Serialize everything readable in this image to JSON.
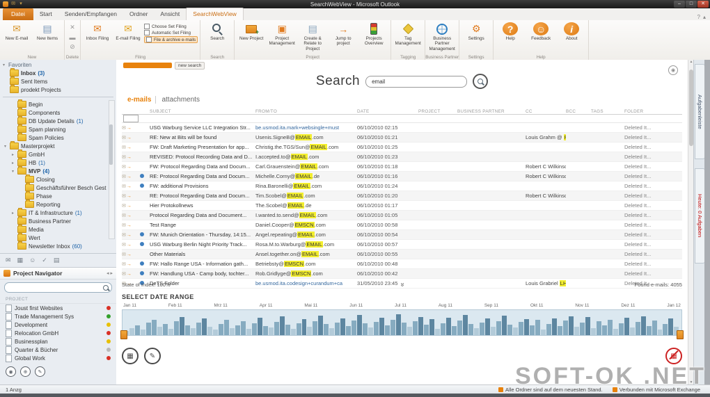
{
  "window": {
    "title": "SearchWebView - Microsoft Outlook"
  },
  "ribbon": {
    "tabs": [
      {
        "label": "Datei",
        "file": true
      },
      {
        "label": "Start"
      },
      {
        "label": "Senden/Empfangen"
      },
      {
        "label": "Ordner"
      },
      {
        "label": "Ansicht"
      },
      {
        "label": "SearchWebView",
        "active": true
      }
    ],
    "groups": [
      {
        "label": "New",
        "buttons": [
          {
            "label": "New E-mail",
            "icon": "new-email"
          },
          {
            "label": "New Items",
            "icon": "new-items"
          }
        ]
      },
      {
        "label": "Delete",
        "icons": [
          "ignore",
          "sweep",
          "junk"
        ]
      },
      {
        "label": "Filing",
        "buttons": [
          {
            "label": "Inbox Filing",
            "icon": "inbox-filing"
          },
          {
            "label": "E-mail Filing",
            "icon": "email-filing"
          }
        ],
        "checks": [
          "Choose Set Filing",
          "Automatic Set Filing",
          "File & archive e-mails"
        ]
      },
      {
        "label": "Search",
        "buttons": [
          {
            "label": "Search",
            "icon": "search"
          }
        ]
      },
      {
        "label": "Project",
        "buttons": [
          {
            "label": "New Project",
            "icon": "new-project"
          },
          {
            "label": "Project Management",
            "icon": "project-management"
          },
          {
            "label": "Create & Relate to Project",
            "icon": "create-relate"
          },
          {
            "label": "Jump to project",
            "icon": "jump-project"
          },
          {
            "label": "Projects Overview",
            "icon": "projects-overview"
          }
        ]
      },
      {
        "label": "Tagging",
        "buttons": [
          {
            "label": "Tag Management",
            "icon": "tag-management"
          }
        ]
      },
      {
        "label": "Business Partner",
        "buttons": [
          {
            "label": "Business Partner Management",
            "icon": "business-partner"
          }
        ]
      },
      {
        "label": "Settings",
        "buttons": [
          {
            "label": "Settings",
            "icon": "settings"
          }
        ]
      },
      {
        "label": "Help",
        "buttons": [
          {
            "label": "Help",
            "icon": "help"
          },
          {
            "label": "Feedback",
            "icon": "feedback"
          },
          {
            "label": "About",
            "icon": "about"
          }
        ]
      }
    ]
  },
  "nav": {
    "favorites_header": "Favoriten",
    "favorites": [
      {
        "label": "Inbox",
        "count": "3",
        "bold": true
      },
      {
        "label": "Sent Items"
      },
      {
        "label": "prodekt Projects"
      }
    ],
    "tree": [
      {
        "label": "Begin",
        "level": 1
      },
      {
        "label": "Components",
        "level": 1
      },
      {
        "label": "DB Update Details",
        "count": "1",
        "level": 1
      },
      {
        "label": "Spam planning",
        "level": 1
      },
      {
        "label": "Spam Policies",
        "level": 1
      },
      {
        "label": "Masterprojekt",
        "level": 0,
        "arrow": "▾"
      },
      {
        "label": "GmbH",
        "level": 1,
        "arrow": "▸"
      },
      {
        "label": "HB",
        "count": "1",
        "level": 1,
        "arrow": "▸"
      },
      {
        "label": "MVP",
        "count": "4",
        "level": 1,
        "arrow": "▾",
        "bold": true
      },
      {
        "label": "Closing",
        "level": 2
      },
      {
        "label": "Geschäftsführer Besch Gest",
        "level": 2
      },
      {
        "label": "Phase",
        "level": 2
      },
      {
        "label": "Reporting",
        "level": 2
      },
      {
        "label": "IT & Infrastructure",
        "count": "1",
        "level": 1,
        "arrow": "▸"
      },
      {
        "label": "Business Partner",
        "level": 1
      },
      {
        "label": "Media",
        "level": 1
      },
      {
        "label": "Wert",
        "level": 1
      },
      {
        "label": "Newsletter Inbox",
        "count": "60",
        "level": 1
      }
    ],
    "modules": [
      "mail",
      "calendar",
      "contacts",
      "tasks",
      "notes"
    ],
    "project_navigator": {
      "title": "Project Navigator",
      "header": "PROJECT",
      "search_value": "",
      "items": [
        {
          "label": "Joust first Websites",
          "status": "#d93025"
        },
        {
          "label": "Trade Management Sys",
          "status": "#34a02c"
        },
        {
          "label": "Development",
          "status": "#e8c000"
        },
        {
          "label": "Relocation GmbH",
          "status": "#d93025"
        },
        {
          "label": "Businessplan",
          "status": "#e8c000"
        },
        {
          "label": "Quarter & Bücher",
          "status": "#b9b9b9"
        },
        {
          "label": "Global Work",
          "status": "#d93025"
        }
      ]
    }
  },
  "search": {
    "title": "Search",
    "value": "email",
    "new_search_label": "new search",
    "tabs": [
      {
        "label": "e-mails",
        "active": true
      },
      {
        "label": "attachments",
        "active": false
      }
    ]
  },
  "table": {
    "columns": [
      "",
      "",
      "SUBJECT",
      "FROM/TO",
      "DATE",
      "PROJECT",
      "BUSINESS PARTNER",
      "CC",
      "BCC",
      "TAGS",
      "FOLDER"
    ],
    "rows": [
      {
        "attach": false,
        "link": true,
        "subject": "USG Warburg Service LLC Integration Str...",
        "from_pre": "be.usmod.ita.mark+websingle+must",
        "from_hl": "",
        "from_post": "",
        "date": "06/10/2010 02:15",
        "project": "",
        "partner": "",
        "cc_pre": "",
        "cc_hl": "",
        "cc_post": "",
        "bcc": "",
        "tags": "",
        "folder": "Deleted It..."
      },
      {
        "attach": false,
        "link": false,
        "subject": "RE: New at Bits will be found",
        "from_pre": "Usenis.SigneB@",
        "from_hl": "EMAIL",
        "from_post": ".com",
        "date": "06/10/2010 01:21",
        "project": "",
        "partner": "",
        "cc_pre": "Louis Grahm @ ",
        "cc_hl": "PM",
        "cc_post": "",
        "bcc": "",
        "tags": "",
        "folder": "Deleted It..."
      },
      {
        "attach": false,
        "link": false,
        "subject": "FW: Draft Marketing Presentation for app...",
        "from_pre": "Christig.the.TGS/Sun@",
        "from_hl": "EMAIL",
        "from_post": ".com",
        "date": "06/10/2010 01:25",
        "project": "",
        "partner": "",
        "cc_pre": "",
        "cc_hl": "",
        "cc_post": "",
        "bcc": "",
        "tags": "",
        "folder": "Deleted It..."
      },
      {
        "attach": false,
        "link": false,
        "subject": "REVISED: Protocol Recording Data and D...",
        "from_pre": "I.accepted.to@",
        "from_hl": "EMAIL",
        "from_post": ".com",
        "date": "06/10/2010 01:23",
        "project": "",
        "partner": "",
        "cc_pre": "",
        "cc_hl": "",
        "cc_post": "",
        "bcc": "",
        "tags": "",
        "folder": "Deleted It..."
      },
      {
        "attach": false,
        "link": false,
        "subject": "FW: Protocol Regarding Data and Docum...",
        "from_pre": "Carl.Grauenstein@",
        "from_hl": "EMAIL",
        "from_post": ".com",
        "date": "06/10/2010 01:18",
        "project": "",
        "partner": "",
        "cc_pre": "Robert C Wilkinson",
        "cc_hl": "",
        "cc_post": "",
        "bcc": "",
        "tags": "",
        "folder": "Deleted It..."
      },
      {
        "attach": true,
        "link": false,
        "subject": "RE: Protocol Regarding Data and Docum...",
        "from_pre": "Michelle.Corny@",
        "from_hl": "EMAIL",
        "from_post": ".de",
        "date": "06/10/2010 01:16",
        "project": "",
        "partner": "",
        "cc_pre": "Robert C Wilkinson",
        "cc_hl": "",
        "cc_post": "",
        "bcc": "",
        "tags": "",
        "folder": "Deleted It..."
      },
      {
        "attach": true,
        "link": false,
        "subject": "FW: additional Provisions",
        "from_pre": "Rina.Baronelli@",
        "from_hl": "EMAIL",
        "from_post": ".com",
        "date": "06/10/2010 01:24",
        "project": "",
        "partner": "",
        "cc_pre": "",
        "cc_hl": "",
        "cc_post": "",
        "bcc": "",
        "tags": "",
        "folder": "Deleted It..."
      },
      {
        "attach": false,
        "link": false,
        "subject": "RE: Protocol Regarding Data and Docum...",
        "from_pre": "Tim.Scobel@",
        "from_hl": "EMAIL",
        "from_post": ".com",
        "date": "06/10/2010 01:20",
        "project": "",
        "partner": "",
        "cc_pre": "Robert C Wilkinson",
        "cc_hl": "",
        "cc_post": "",
        "bcc": "",
        "tags": "",
        "folder": "Deleted It..."
      },
      {
        "attach": false,
        "link": false,
        "subject": "Hier Protokollnews",
        "from_pre": "The.Scobel@",
        "from_hl": "EMAIL",
        "from_post": ".de",
        "date": "06/10/2010 01:17",
        "project": "",
        "partner": "",
        "cc_pre": "",
        "cc_hl": "",
        "cc_post": "",
        "bcc": "",
        "tags": "",
        "folder": "Deleted It..."
      },
      {
        "attach": false,
        "link": false,
        "subject": "Protocol Regarding Data and Document...",
        "from_pre": "I.wanted.to.send@",
        "from_hl": "EMAIL",
        "from_post": ".com",
        "date": "06/10/2010 01:05",
        "project": "",
        "partner": "",
        "cc_pre": "",
        "cc_hl": "",
        "cc_post": "",
        "bcc": "",
        "tags": "",
        "folder": "Deleted It..."
      },
      {
        "attach": false,
        "link": false,
        "subject": "Test Range",
        "from_pre": "Daniel.Cooper@",
        "from_hl": "EMSCN",
        "from_post": ".com",
        "date": "06/10/2010 00:58",
        "project": "",
        "partner": "",
        "cc_pre": "",
        "cc_hl": "",
        "cc_post": "",
        "bcc": "",
        "tags": "",
        "folder": "Deleted It..."
      },
      {
        "attach": true,
        "link": false,
        "subject": "FW: Munich Orientation - Thursday, 14:15...",
        "from_pre": "Angel.repeating@",
        "from_hl": "EMAIL",
        "from_post": ".com",
        "date": "06/10/2010 00:54",
        "project": "",
        "partner": "",
        "cc_pre": "",
        "cc_hl": "",
        "cc_post": "",
        "bcc": "",
        "tags": "",
        "folder": "Deleted It..."
      },
      {
        "attach": true,
        "link": false,
        "subject": "USG Warburg Berlin Night Priority Track...",
        "from_pre": "Rosa.M.to.Warburg@",
        "from_hl": "EMAIL",
        "from_post": ".com",
        "date": "06/10/2010 00:57",
        "project": "",
        "partner": "",
        "cc_pre": "",
        "cc_hl": "",
        "cc_post": "",
        "bcc": "",
        "tags": "",
        "folder": "Deleted It..."
      },
      {
        "attach": false,
        "link": false,
        "subject": "Other Materials",
        "from_pre": "Ansel.together.on@",
        "from_hl": "EMAIL",
        "from_post": ".com",
        "date": "06/10/2010 00:55",
        "project": "",
        "partner": "",
        "cc_pre": "",
        "cc_hl": "",
        "cc_post": "",
        "bcc": "",
        "tags": "",
        "folder": "Deleted It..."
      },
      {
        "attach": true,
        "link": false,
        "subject": "FW: Hallo Range USA - Information gath...",
        "from_pre": "Betriebsty@",
        "from_hl": "EMSCN",
        "from_post": ".com",
        "date": "06/10/2010 00:48",
        "project": "",
        "partner": "",
        "cc_pre": "",
        "cc_hl": "",
        "cc_post": "",
        "bcc": "",
        "tags": "",
        "folder": "Deleted It..."
      },
      {
        "attach": true,
        "link": false,
        "subject": "FW: Handlung USA - Camp body, tochter...",
        "from_pre": "Rob.Gridlyge@",
        "from_hl": "EMSCN",
        "from_post": ".com",
        "date": "06/10/2010 00:42",
        "project": "",
        "partner": "",
        "cc_pre": "",
        "cc_hl": "",
        "cc_post": "",
        "bcc": "",
        "tags": "",
        "folder": "Deleted It..."
      },
      {
        "attach": true,
        "link": true,
        "subject": "DeTS Folder",
        "from_pre": "be.usmod.ita.codesign+curandum+ca",
        "from_hl": "",
        "from_post": "",
        "date": "31/05/2010 23:45",
        "project": "",
        "partner": "",
        "cc_pre": "Louis Grabriel ",
        "cc_hl": "LH",
        "cc_post": "",
        "bcc": "",
        "tags": "",
        "folder": "Deleted It..."
      }
    ]
  },
  "footer": {
    "index_label": "State of Index: 100%",
    "found_label": "Found e-mails: 4055"
  },
  "daterange": {
    "title": "SELECT DATE RANGE",
    "months": [
      "Jan 11",
      "Feb 11",
      "Mrz 11",
      "Apr 11",
      "Mai 11",
      "Jun 11",
      "Jul 11",
      "Aug 11",
      "Sep 11",
      "Okt 11",
      "Nov 11",
      "Dez 11",
      "Jan 12"
    ],
    "bars": [
      6,
      10,
      14,
      8,
      18,
      22,
      12,
      16,
      9,
      20,
      26,
      14,
      10,
      18,
      24,
      12,
      8,
      16,
      22,
      10,
      14,
      20,
      9,
      17,
      25,
      13,
      11,
      19,
      27,
      15,
      9,
      17,
      23,
      12,
      20,
      28,
      16,
      10,
      18,
      24,
      13,
      21,
      29,
      17,
      11,
      19,
      25,
      14,
      22,
      30,
      18,
      12,
      20,
      26,
      15,
      23,
      9,
      17,
      25,
      13,
      21,
      29,
      16,
      10,
      18,
      24,
      12,
      20,
      28,
      15,
      11,
      19,
      23,
      14,
      22,
      8,
      16,
      24,
      13,
      21,
      27,
      12,
      18,
      26,
      10,
      20,
      14,
      22,
      9,
      17,
      25,
      11,
      19,
      27,
      13,
      21,
      8,
      16,
      24,
      12
    ]
  },
  "rightbar": {
    "tabs": [
      {
        "label": "Aufgabenleiste",
        "color": "#44546a"
      },
      {
        "label": "Heute: 0 Aufgaben",
        "color": "#c00000"
      }
    ]
  },
  "statusbar": {
    "left": "1 Anzg",
    "items": [
      "Alle Ordner sind auf dem neuesten Stand.",
      "Verbunden mit Microsoft Exchange"
    ]
  },
  "watermark": {
    "text": "SOFT-OK .NET"
  },
  "colors": {
    "accent": "#e8820c",
    "highlight": "#f3ee2e",
    "unread_count": "#1b62a8"
  }
}
